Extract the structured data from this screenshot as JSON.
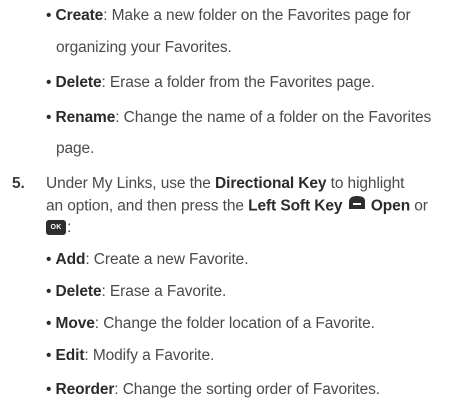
{
  "folder_options": [
    {
      "term": "Create",
      "desc_1": ": Make a new folder on the Favorites page for",
      "desc_2": "organizing your Favorites."
    },
    {
      "term": "Delete",
      "desc_1": ": Erase a folder from the Favorites page."
    },
    {
      "term": "Rename",
      "desc_1": ": Change the name of a folder on the Favorites",
      "desc_2": "page."
    }
  ],
  "step5": {
    "number": "5.",
    "l1_a": "Under My Links, use the ",
    "l1_b": "Directional Key",
    "l1_c": " to highlight",
    "l2_a": "an option, and then press the ",
    "l2_b": "Left Soft Key",
    "l2_c": "Open",
    "l2_d": " or",
    "ok_label": "OK",
    "l3_end": ":"
  },
  "link_options": [
    {
      "term": "Add",
      "desc": ": Create a new Favorite."
    },
    {
      "term": "Delete",
      "desc": ": Erase a Favorite."
    },
    {
      "term": "Move",
      "desc": ": Change the folder location of a Favorite."
    },
    {
      "term": "Edit",
      "desc": ": Modify a Favorite."
    },
    {
      "term": "Reorder",
      "desc": ": Change the sorting order of Favorites."
    }
  ]
}
